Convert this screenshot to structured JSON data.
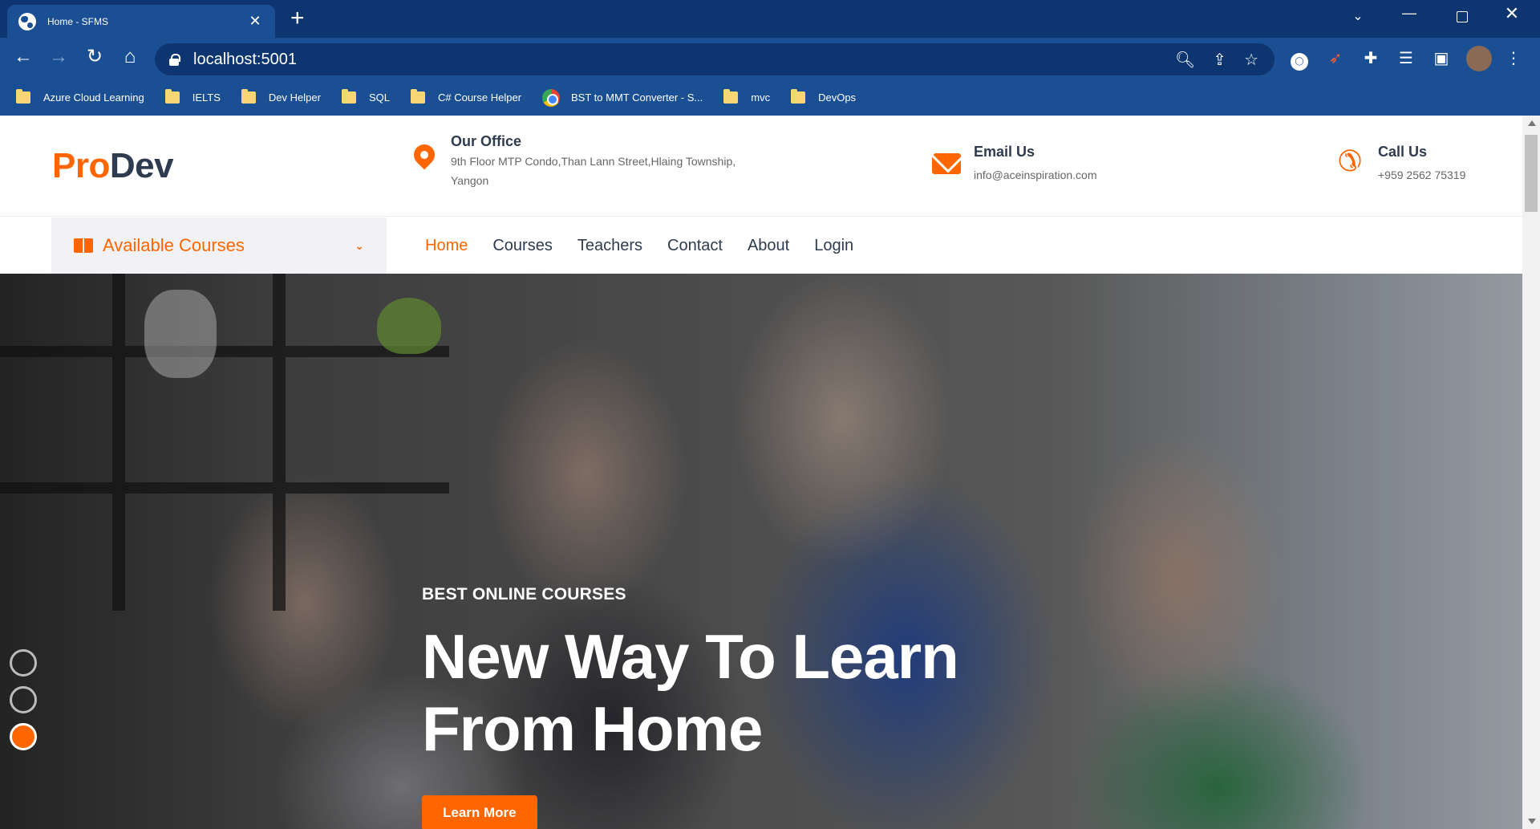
{
  "browser": {
    "tab_title": "Home - SFMS",
    "url": "localhost:5001",
    "bookmarks": [
      {
        "label": "Azure Cloud Learning",
        "icon": "folder-icon"
      },
      {
        "label": "IELTS",
        "icon": "folder-icon"
      },
      {
        "label": "Dev Helper",
        "icon": "folder-icon"
      },
      {
        "label": "SQL",
        "icon": "folder-icon"
      },
      {
        "label": "C# Course Helper",
        "icon": "folder-icon"
      },
      {
        "label": "BST to MMT Converter - S...",
        "icon": "chrome-icon"
      },
      {
        "label": "mvc",
        "icon": "folder-icon"
      },
      {
        "label": "DevOps",
        "icon": "folder-icon"
      }
    ]
  },
  "site": {
    "logo_pro": "Pro",
    "logo_dev": "Dev",
    "office": {
      "title": "Our Office",
      "line1": "9th Floor MTP Condo,Than Lann Street,Hlaing Township,",
      "line2": "Yangon"
    },
    "email": {
      "title": "Email Us",
      "value": "info@aceinspiration.com"
    },
    "call": {
      "title": "Call Us",
      "value": "+959 2562 75319"
    },
    "courses_dropdown": "Available Courses",
    "nav": [
      "Home",
      "Courses",
      "Teachers",
      "Contact",
      "About",
      "Login"
    ],
    "active_nav": "Home"
  },
  "hero": {
    "kicker": "BEST ONLINE COURSES",
    "headline_line1": "New Way To Learn",
    "headline_line2": "From Home",
    "cta": "Learn More",
    "slides": 3,
    "active_slide": 3
  },
  "colors": {
    "accent": "#ff6600",
    "chrome_dark": "#0d3570",
    "chrome": "#1b4f94",
    "text_dark": "#2f3b4f"
  }
}
